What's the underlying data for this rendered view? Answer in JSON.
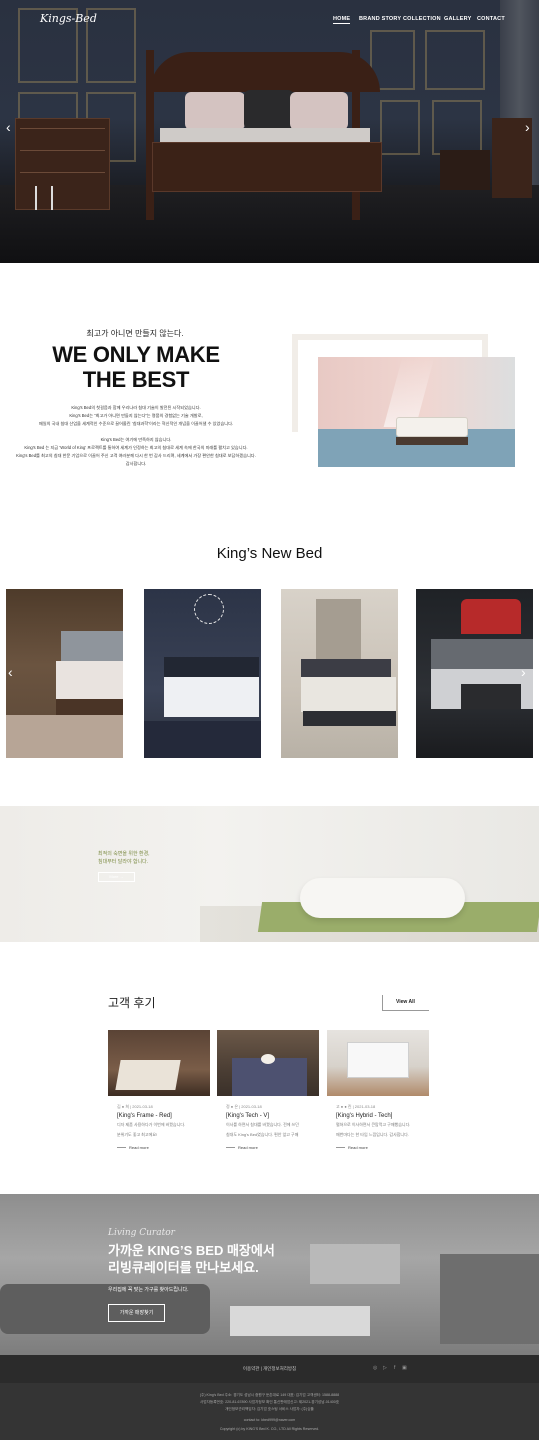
{
  "header": {
    "logo": "Kings-Bed",
    "nav": [
      "HOME",
      "BRAND STORY",
      "COLLECTION",
      "GALLERY",
      "CONTACT"
    ],
    "prev_icon": "‹",
    "next_icon": "›"
  },
  "intro": {
    "subtitle": "최고가 아니면 만들지 않는다.",
    "title_line1": "WE ONLY MAKE",
    "title_line2": "THE BEST",
    "para1_l1": "King's Bed의 첫걸음과 함께 우리나라 침대 기술이 발전된 시작되었습니다.",
    "para1_l2": "King's Bed는 “최고가 아니면 만들지 않는다”는 명품의 경험없는 기술 개발로,",
    "para1_l3": "매일의 국내 침대 산업을 세계적인 수준으로 끌어올린 ‘침대과학’이라는 혁신적인 개념을 이끌어낼 수 있었습니다.",
    "para2_l1": "King's Bed는 여기에 만족하지 않습니다.",
    "para2_l2": "King's Bed 는 지금 ‘World of King’ 프로젝트를 통하여 세계가 인정하는 최고의 침대로 세계 속에 한국의 미래를 펼치고 있습니다.",
    "para2_l3": "King's Bed를 최고의 침대 한문 기업으로 이끌어 주신 고객 여러분께 다시 한 번 감사 드리며, 세계에서 가장 편안한 침대로 보답하겠습니다.",
    "para2_l4": "감사합니다."
  },
  "new_bed": {
    "title": "King’s New Bed",
    "prev_icon": "‹",
    "next_icon": "›"
  },
  "banner": {
    "line1": "최적의 숙면을 위한 환경,",
    "line2": "침대부터 달라야 합니다.",
    "button": "More →"
  },
  "reviews": {
    "title": "고객 후기",
    "view_all": "View All",
    "items": [
      {
        "meta": "김 ● 희 | 2021-03-18",
        "title": "[King's Frame - Red]",
        "l1": "디자 제품 사용하다가 이번에 바꿨습니다.",
        "l2": "분위기도 좋고 최고에요!",
        "more": "Read more"
      },
      {
        "meta": "정 ● 은 | 2021-03-18",
        "title": "[King's Tech - V]",
        "l1": "이사를 하면서 침대를 바꿨습니다. 전에 쓰던",
        "l2": "침대도 King's Bed였습니다. 편안 앞고 구매",
        "more": "Read more"
      },
      {
        "meta": "고 ● ● 린 | 2021-03-18",
        "title": "[King's Hybrid - Tech]",
        "l1": "펼쳐으로 이사하면서 큰맘먹고 구매했습니다.",
        "l2": "매번마다는 한 타임 느낌입니다. 감사합니다.",
        "more": "Read more"
      }
    ]
  },
  "curator": {
    "script_title": "Living Curator",
    "headline1": "가까운 KING’S BED 매장에서",
    "headline2": "리빙큐레이터를 만나보세요.",
    "sub": "우리집에 꼭 맞는 가구를 찾아드립니다.",
    "button": "가까운 매장찾기"
  },
  "footer": {
    "links": "이용약관  |  개인정보처리방침",
    "social": [
      "◎",
      "▷",
      "f",
      "▣"
    ],
    "info1": "(주) King's Bed      주소: 경기도 성남시 중원구 둔촌대로 149      대표: 김기업      고객센터: 1588-8888",
    "info2": "사업자등록번호: 220-81-67890      사업자정보 확인      통신판매업신고: 제2021-경기성남-01400호",
    "info3": "개인정보관리책임자: 김기업      호스팅 서비스 사업자: (주)심플",
    "email": "contact to: kbed999@naver.com",
    "copyright": "Copyright (c) by KING'S Bed K. CO., LTD All Rights Reserved."
  },
  "colors": {
    "accent_green": "#8a9a4a",
    "footer_bg": "#2b2b2b"
  }
}
